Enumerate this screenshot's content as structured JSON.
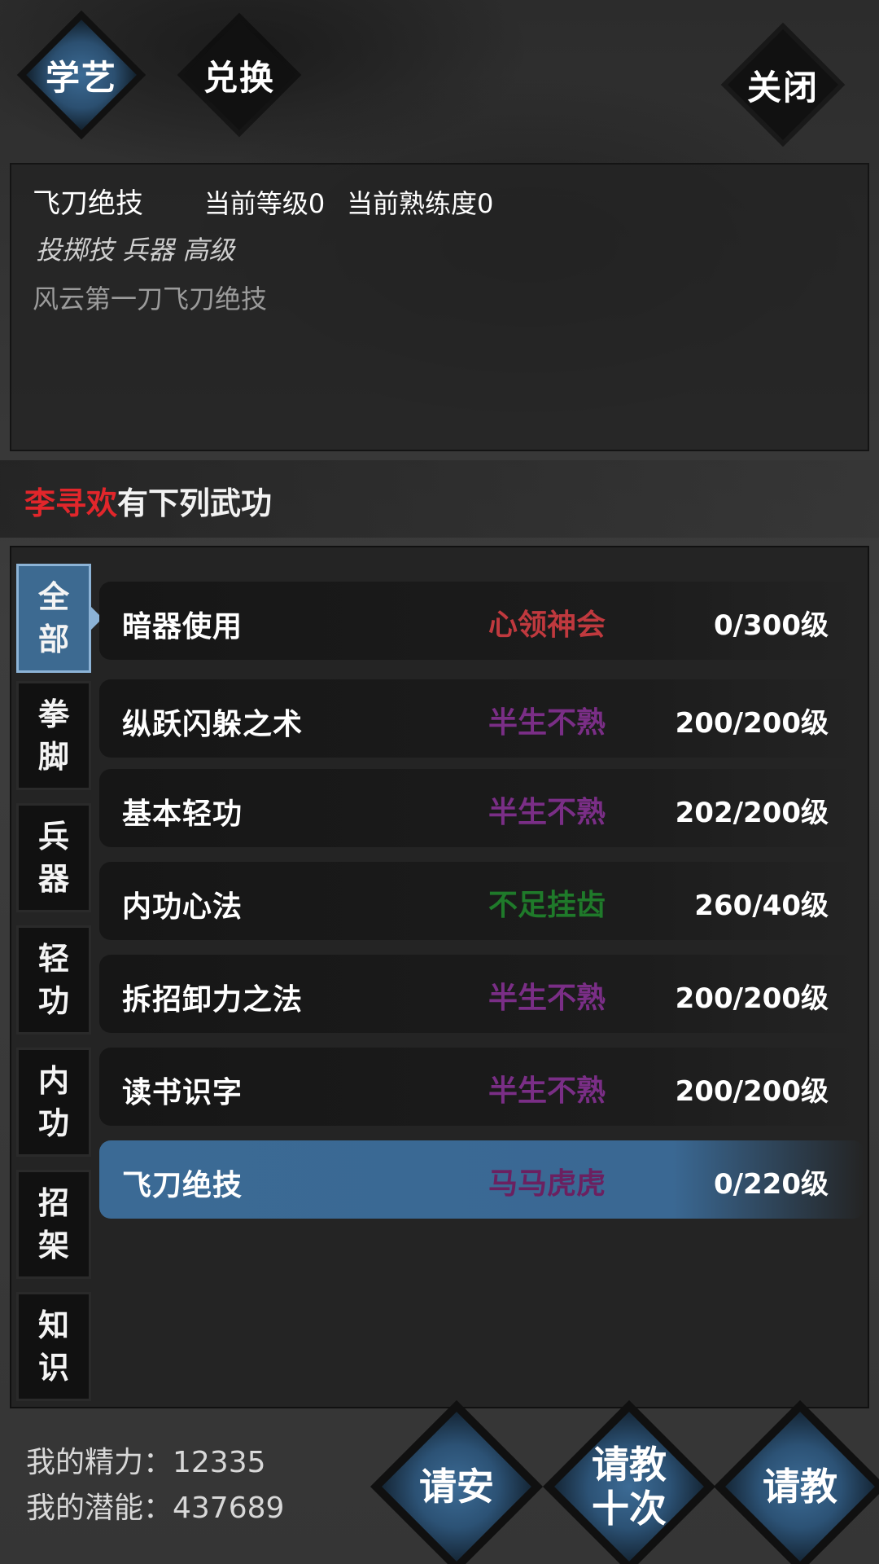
{
  "tabs": [
    {
      "label": "学艺",
      "active": true
    },
    {
      "label": "兑换",
      "active": false
    }
  ],
  "close_label": "关闭",
  "info": {
    "skill_name": "飞刀绝技",
    "current_level": "当前等级0",
    "current_proficiency": "当前熟练度0",
    "tags": "投掷技 兵器 高级",
    "description": "风云第一刀飞刀绝技"
  },
  "heading": {
    "name": "李寻欢",
    "suffix": "有下列武功"
  },
  "categories": [
    {
      "line1": "全",
      "line2": "部",
      "active": true
    },
    {
      "line1": "拳",
      "line2": "脚"
    },
    {
      "line1": "兵",
      "line2": "器"
    },
    {
      "line1": "轻",
      "line2": "功"
    },
    {
      "line1": "内",
      "line2": "功"
    },
    {
      "line1": "招",
      "line2": "架"
    },
    {
      "line1": "知",
      "line2": "识"
    }
  ],
  "skills": [
    {
      "name": "暗器使用",
      "status": "心领神会",
      "status_color": "#c0393e",
      "level": "0/300级"
    },
    {
      "name": "纵跃闪躲之术",
      "status": "半生不熟",
      "status_color": "#7a2e86",
      "level": "200/200级"
    },
    {
      "name": "基本轻功",
      "status": "半生不熟",
      "status_color": "#7a2e86",
      "level": "202/200级"
    },
    {
      "name": "内功心法",
      "status": "不足挂齿",
      "status_color": "#1f7a2a",
      "level": "260/40级"
    },
    {
      "name": "拆招卸力之法",
      "status": "半生不熟",
      "status_color": "#7a2e86",
      "level": "200/200级"
    },
    {
      "name": "读书识字",
      "status": "半生不熟",
      "status_color": "#7a2e86",
      "level": "200/200级"
    },
    {
      "name": "飞刀绝技",
      "status": "马马虎虎",
      "status_color": "#6b2060",
      "level": "0/220级",
      "active": true
    }
  ],
  "stats": {
    "energy": "我的精力：12335",
    "potential": "我的潜能：437689"
  },
  "buttons": {
    "greet": "请安",
    "ask_ten_line1": "请教",
    "ask_ten_line2": "十次",
    "ask": "请教"
  },
  "colors": {
    "accent_blue": "#3b6a95",
    "name_red": "#e2262b"
  }
}
